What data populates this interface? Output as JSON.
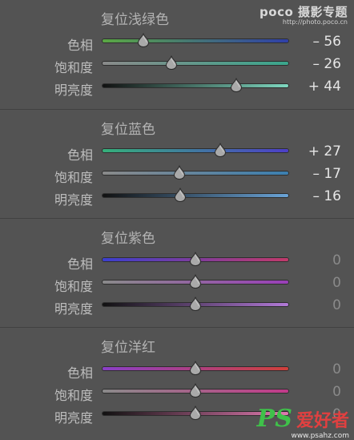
{
  "watermark_top": {
    "brand": "poco 摄影专题",
    "url": "http://photo.poco.cn"
  },
  "watermark_bottom": {
    "ps": "PS",
    "cn": "爱好者",
    "url": "www.psahz.com"
  },
  "sections": [
    {
      "title": "复位浅绿色",
      "rows": [
        {
          "label": "色相",
          "value": "– 56",
          "level": -56,
          "track": [
            "#5aa843",
            "#2f3fa8"
          ]
        },
        {
          "label": "饱和度",
          "value": "– 26",
          "level": -26,
          "track": [
            "#8a8a8a",
            "#3aa68c"
          ]
        },
        {
          "label": "明亮度",
          "value": "+ 44",
          "level": 44,
          "track": [
            "#111111",
            "#7fd8c0"
          ]
        }
      ]
    },
    {
      "title": "复位蓝色",
      "rows": [
        {
          "label": "色相",
          "value": "+ 27",
          "level": 27,
          "track": [
            "#35b07a",
            "#4d3fc8"
          ]
        },
        {
          "label": "饱和度",
          "value": "– 17",
          "level": -17,
          "track": [
            "#8a8a8a",
            "#3b7fb0"
          ]
        },
        {
          "label": "明亮度",
          "value": "– 16",
          "level": -16,
          "track": [
            "#111111",
            "#6aa4d8"
          ]
        }
      ]
    },
    {
      "title": "复位紫色",
      "rows": [
        {
          "label": "色相",
          "value": "0",
          "level": 0,
          "track": [
            "#3b3fcf",
            "#c23a6a"
          ]
        },
        {
          "label": "饱和度",
          "value": "0",
          "level": 0,
          "track": [
            "#8a8a8a",
            "#9a3fb8"
          ]
        },
        {
          "label": "明亮度",
          "value": "0",
          "level": 0,
          "track": [
            "#111111",
            "#b27ad8"
          ]
        }
      ]
    },
    {
      "title": "复位洋红",
      "rows": [
        {
          "label": "色相",
          "value": "0",
          "level": 0,
          "track": [
            "#8a3fc8",
            "#d0403a"
          ]
        },
        {
          "label": "饱和度",
          "value": "0",
          "level": 0,
          "track": [
            "#8a8a8a",
            "#c23a8a"
          ]
        },
        {
          "label": "明亮度",
          "value": "0",
          "level": 0,
          "track": [
            "#111111",
            "#e07ab0"
          ]
        }
      ]
    }
  ]
}
